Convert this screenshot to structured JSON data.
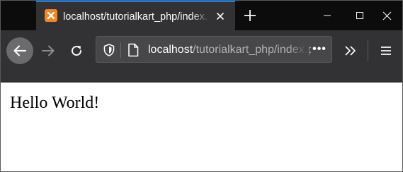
{
  "tab": {
    "title": "localhost/tutorialkart_php/index.php",
    "favicon": "xampp-icon"
  },
  "urlbar": {
    "host": "localhost",
    "path": "/tutorialkart_php/index.php",
    "page_actions": "•••"
  },
  "page": {
    "heading": "Hello World!"
  },
  "colors": {
    "tab_accent": "#0a84ff",
    "toolbar": "#323234",
    "tabstrip": "#0c0c0d",
    "favicon": "#f7841f"
  }
}
